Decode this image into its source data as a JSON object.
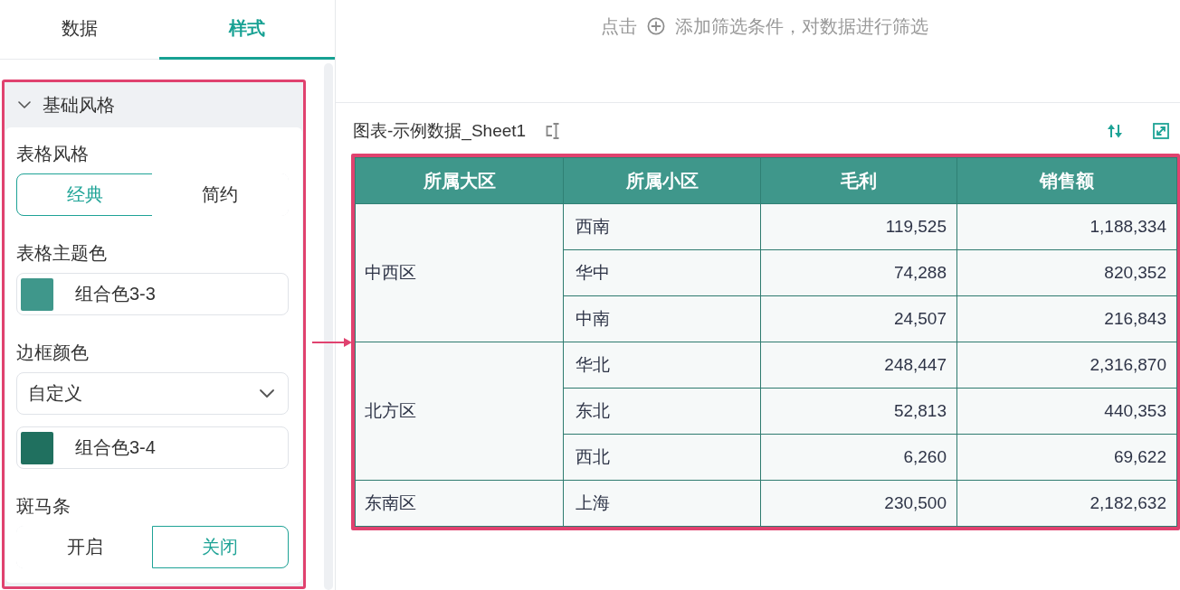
{
  "panel_tabs": [
    {
      "label": "数据",
      "selected": false
    },
    {
      "label": "样式",
      "selected": true
    }
  ],
  "style_section": {
    "title": "基础风格",
    "expanded": true,
    "highlighted": true,
    "fields": [
      {
        "kind": "segmented",
        "label": "表格风格",
        "options": [
          {
            "label": "经典",
            "selected": true
          },
          {
            "label": "简约",
            "selected": false
          }
        ]
      },
      {
        "kind": "color",
        "label": "表格主题色",
        "color": "#3f978b",
        "value": "组合色3-3"
      },
      {
        "kind": "select",
        "label": "边框颜色",
        "value": "自定义"
      },
      {
        "kind": "color",
        "color": "#20705f",
        "value": "组合色3-4"
      },
      {
        "kind": "segmented",
        "label": "斑马条",
        "options": [
          {
            "label": "开启",
            "selected": false
          },
          {
            "label": "关闭",
            "selected": true
          }
        ]
      }
    ]
  },
  "filter_hint": {
    "before": "点击",
    "after": "添加筛选条件，对数据进行筛选"
  },
  "chart": {
    "title": "图表-示例数据_Sheet1",
    "highlighted": true,
    "table": {
      "columns": [
        {
          "label": "所属大区",
          "kind": "dimension"
        },
        {
          "label": "所属小区",
          "kind": "dimension"
        },
        {
          "label": "毛利",
          "kind": "measure"
        },
        {
          "label": "销售额",
          "kind": "measure"
        }
      ],
      "groups": [
        {
          "region": "中西区",
          "rows": [
            [
              "西南",
              "119,525",
              "1,188,334"
            ],
            [
              "华中",
              "74,288",
              "820,352"
            ],
            [
              "中南",
              "24,507",
              "216,843"
            ]
          ]
        },
        {
          "region": "北方区",
          "rows": [
            [
              "华北",
              "248,447",
              "2,316,870"
            ],
            [
              "东北",
              "52,813",
              "440,353"
            ],
            [
              "西北",
              "6,260",
              "69,622"
            ]
          ]
        },
        {
          "region": "东南区",
          "rows": [
            [
              "上海",
              "230,500",
              "2,182,632"
            ]
          ]
        }
      ]
    }
  }
}
